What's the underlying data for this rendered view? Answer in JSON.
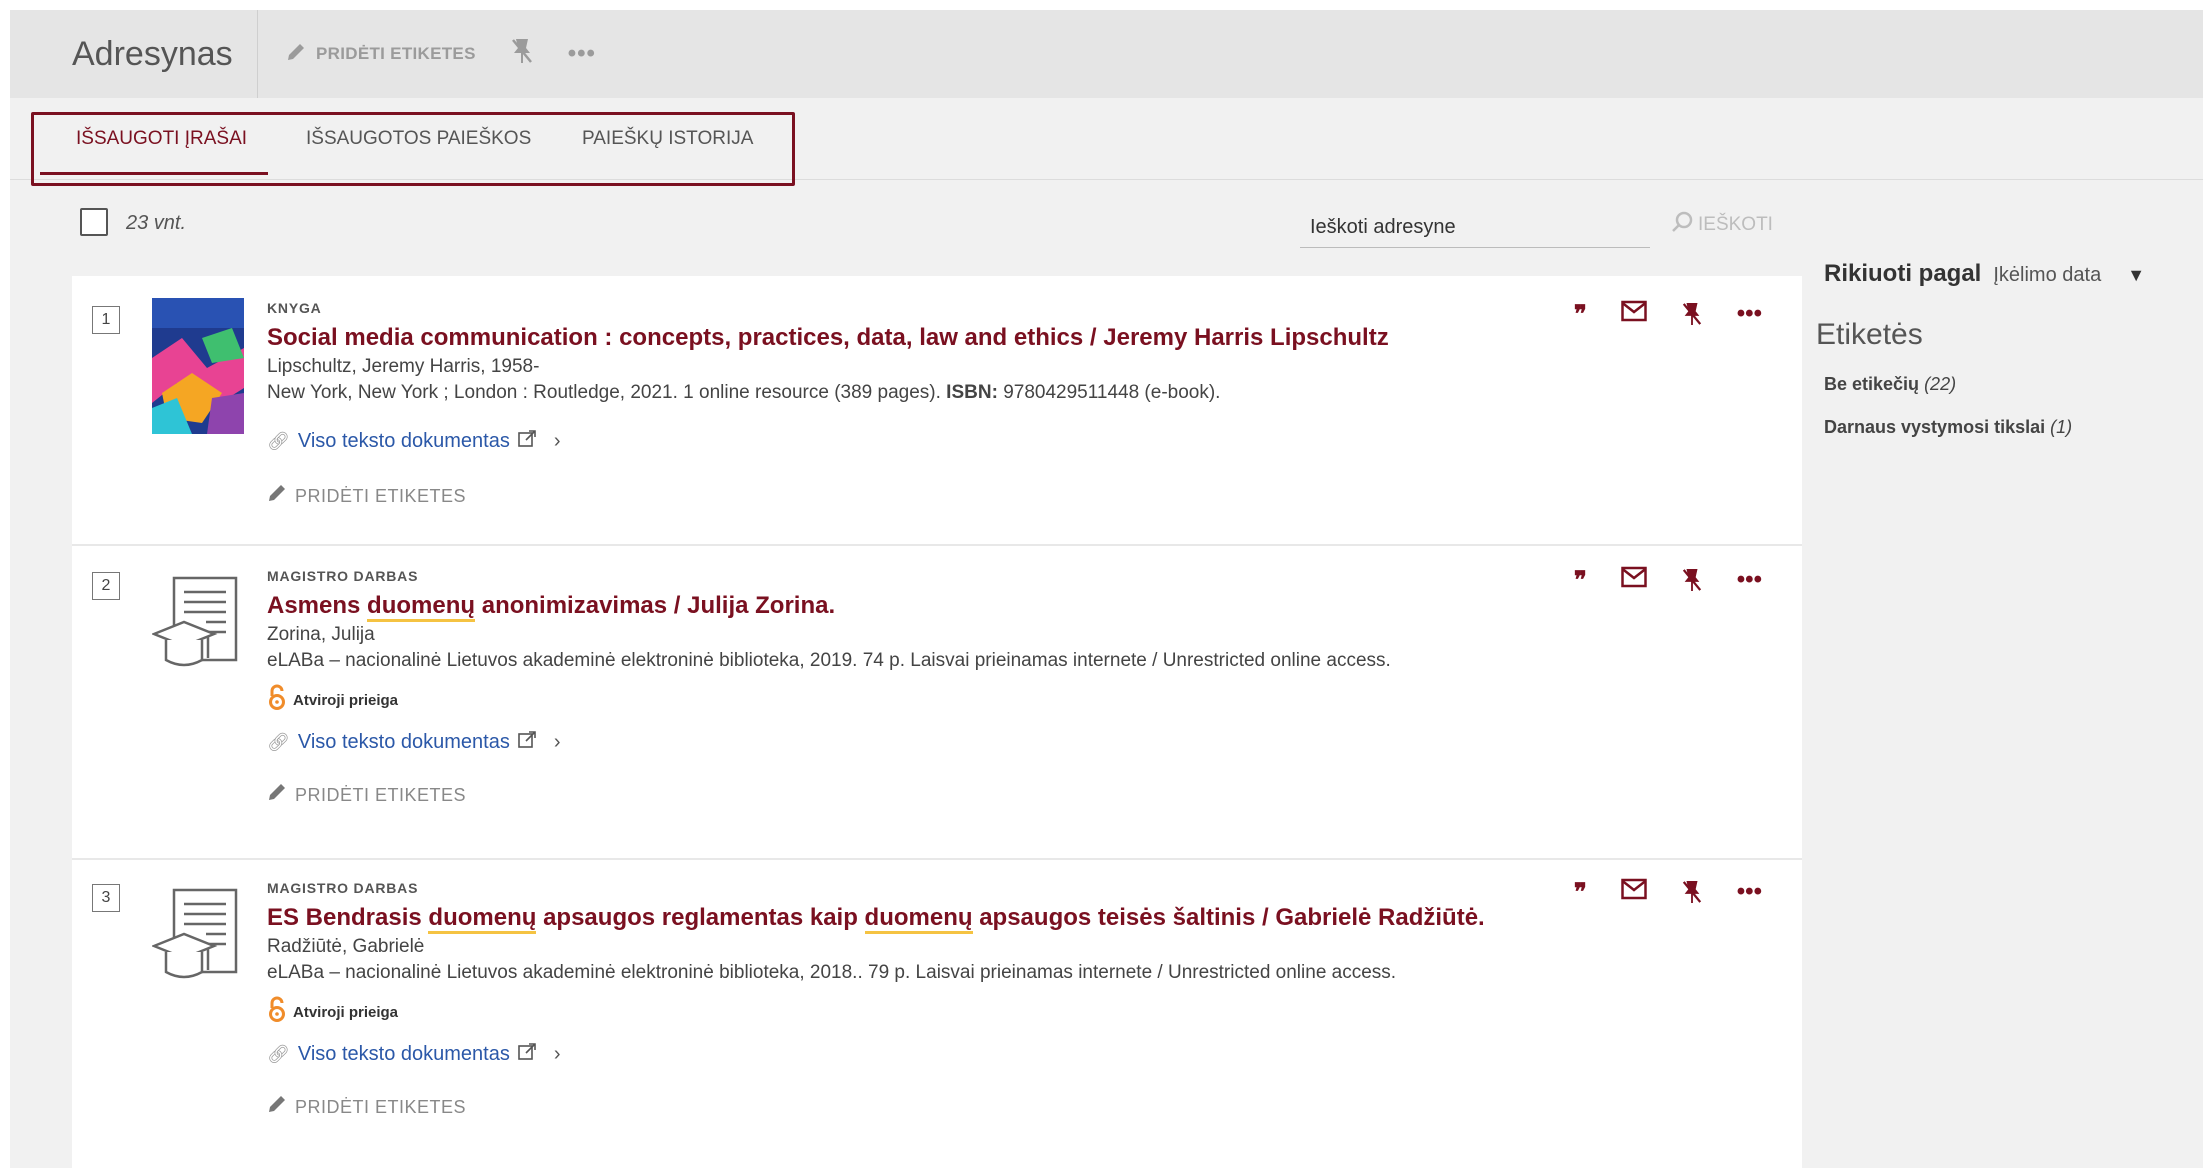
{
  "header": {
    "title": "Adresynas",
    "add_tags_label": "PRIDĖTI ETIKETES"
  },
  "tabs": [
    {
      "label": "IŠSAUGOTI ĮRAŠAI"
    },
    {
      "label": "IŠSAUGOTOS PAIEŠKOS"
    },
    {
      "label": "PAIEŠKŲ ISTORIJA"
    }
  ],
  "toolbar": {
    "count": "23 vnt.",
    "search_placeholder": "Ieškoti adresyne",
    "search_label": "IEŠKOTI"
  },
  "results": [
    {
      "num": "1",
      "type": "KNYGA",
      "title": "Social media communication : concepts, practices, data, law and ethics / Jeremy Harris Lipschultz",
      "author": "Lipschultz, Jeremy Harris, 1958-",
      "pub": "New York, New York ; London : Routledge, 2021. 1 online resource (389 pages).",
      "isbn_label": "ISBN:",
      "isbn": "9780429511448 (e-book).",
      "link": "Viso teksto dokumentas",
      "tags": "PRIDĖTI ETIKETES"
    },
    {
      "num": "2",
      "type": "MAGISTRO DARBAS",
      "title_a": "Asmens ",
      "title_hl": "duomenų",
      "title_b": " anonimizavimas / Julija Zorina.",
      "author": "Zorina, Julija",
      "pub": "eLABa – nacionalinė Lietuvos akademinė elektroninė biblioteka, 2019. 74 p. Laisvai prieinamas internete / Unrestricted online access.",
      "oa": "Atviroji prieiga",
      "link": "Viso teksto dokumentas",
      "tags": "PRIDĖTI ETIKETES"
    },
    {
      "num": "3",
      "type": "MAGISTRO DARBAS",
      "title_a": "ES Bendrasis ",
      "title_hl": "duomenų",
      "title_b": " apsaugos reglamentas kaip ",
      "title_hl2": "duomenų",
      "title_c": " apsaugos teisės šaltinis / Gabrielė Radžiūtė.",
      "author": "Radžiūtė, Gabrielė",
      "pub": "eLABa – nacionalinė Lietuvos akademinė elektroninė biblioteka, 2018.. 79 p. Laisvai prieinamas internete / Unrestricted online access.",
      "oa": "Atviroji prieiga",
      "link": "Viso teksto dokumentas",
      "tags": "PRIDĖTI ETIKETES"
    }
  ],
  "sidebar": {
    "sort_label": "Rikiuoti pagal",
    "sort_value": "Įkėlimo data",
    "tags_title": "Etiketės",
    "tag_items": [
      {
        "label": "Be etikečių",
        "count": "(22)"
      },
      {
        "label": "Darnaus vystymosi tikslai",
        "count": "(1)"
      }
    ]
  },
  "colors": {
    "accent": "#7a1020",
    "link": "#2b58a8",
    "highlight": "#f5c342",
    "open_access": "#f08c2a"
  },
  "icons": [
    "pencil-icon",
    "unpin-icon",
    "more-icon",
    "quote-icon",
    "mail-icon",
    "search-icon",
    "link-icon",
    "external-icon",
    "chevron-right-icon",
    "open-access-icon",
    "chevron-down-icon"
  ]
}
